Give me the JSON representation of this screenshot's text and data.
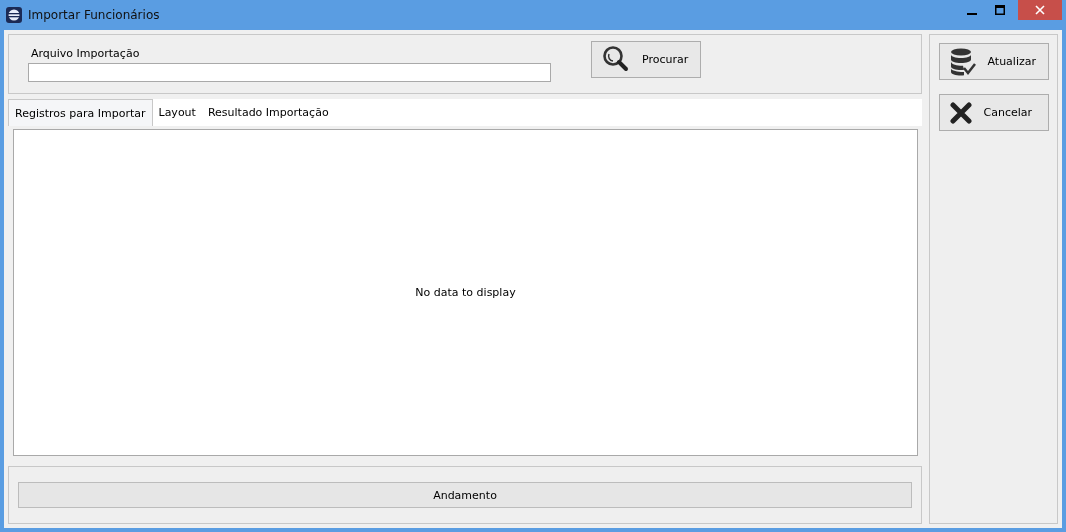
{
  "window": {
    "title": "Importar Funcionários"
  },
  "file_field": {
    "label": "Arquivo Importação"
  },
  "search_button": {
    "label": "Procurar"
  },
  "tabs": [
    {
      "label": "Registros para Importar",
      "selected": true
    },
    {
      "label": "Layout",
      "selected": false
    },
    {
      "label": "Resultado Importação",
      "selected": false
    }
  ],
  "grid": {
    "empty_text": "No data to display"
  },
  "progress": {
    "label": "Andamento",
    "level": 0
  },
  "side_buttons": [
    {
      "kind": "update",
      "label": "Atualizar"
    },
    {
      "kind": "cancel",
      "label": "Cancelar"
    }
  ]
}
